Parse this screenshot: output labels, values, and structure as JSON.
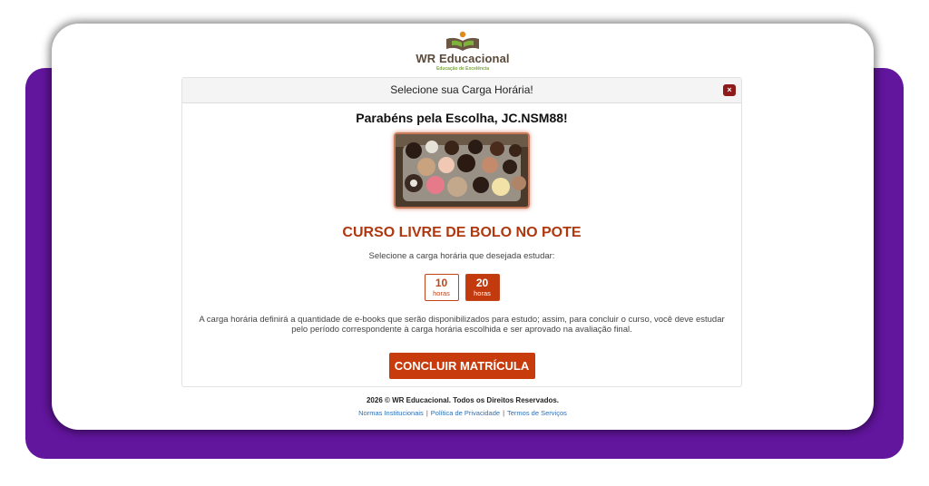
{
  "brand": {
    "name": "WR Educacional",
    "tagline": "Educação de Excelência"
  },
  "dialog": {
    "title": "Selecione sua Carga Horária!",
    "close_symbol": "×",
    "greeting": "Parabéns pela Escolha, JC.NSM88!",
    "course_title": "CURSO LIVRE DE BOLO NO POTE",
    "select_label": "Selecione a carga horária que desejada estudar:",
    "options": [
      {
        "num": "10",
        "unit": "horas",
        "selected": false
      },
      {
        "num": "20",
        "unit": "horas",
        "selected": true
      }
    ],
    "description": "A carga horária definirá a quantidade de e-books que serão disponibilizados para estudo; assim, para concluir o curso, você deve estudar pelo período correspondente à carga horária escolhida e ser aprovado na avaliação final.",
    "cta": "CONCLUIR MATRÍCULA"
  },
  "footer": {
    "copyright": "2026 © WR Educacional. Todos os Direitos Reservados.",
    "links": [
      "Normas Institucionais",
      "Política de Privacidade",
      "Termos de Serviços"
    ],
    "separator": "|"
  },
  "colors": {
    "accent": "#c73b0c",
    "purple": "#62159d",
    "course_title": "#b0370e"
  }
}
